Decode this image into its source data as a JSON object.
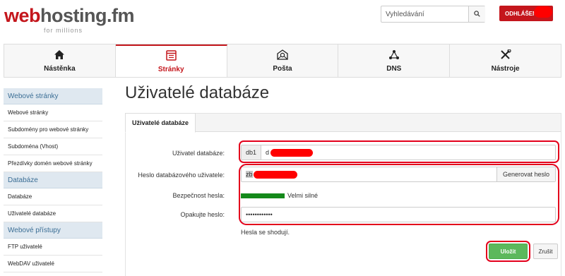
{
  "brand": {
    "logo_web": "web",
    "logo_rest": "hosting.fm",
    "tagline": "for millions"
  },
  "search": {
    "placeholder": "Vyhledávání",
    "button_icon": "search-icon"
  },
  "header": {
    "logout_label": "ODHLÁŠENÍ"
  },
  "topnav": {
    "items": [
      {
        "label": "Nástěnka",
        "icon": "home-icon",
        "glyph": "🏠︎"
      },
      {
        "label": "Stránky",
        "icon": "pages-icon",
        "glyph": "▤",
        "active": true
      },
      {
        "label": "Pošta",
        "icon": "mail-icon",
        "glyph": "✉"
      },
      {
        "label": "DNS",
        "icon": "dns-icon",
        "glyph": "⛬"
      },
      {
        "label": "Nástroje",
        "icon": "tools-icon",
        "glyph": "✂"
      }
    ]
  },
  "sidebar": {
    "sections": [
      {
        "title": "Webové stránky",
        "items": [
          "Webové stránky",
          "Subdomény pro webové stránky",
          "Subdoména (Vhost)",
          "Přezdívky domén webové stránky"
        ]
      },
      {
        "title": "Databáze",
        "items": [
          "Databáze",
          "Uživatelé databáze"
        ]
      },
      {
        "title": "Webové přístupy",
        "items": [
          "FTP uživatelé",
          "WebDAV uživatelé"
        ]
      }
    ]
  },
  "page": {
    "title": "Uživatelé databáze"
  },
  "panel": {
    "tab_label": "Uživatelé databáze",
    "fields": {
      "db_user_label": "Uživatel databáze:",
      "db_user_prefix": "db1",
      "db_user_value": "d",
      "password_label": "Heslo databázového uživatele:",
      "password_value": "zb",
      "generate_label": "Generovat heslo",
      "strength_label": "Bezpečnost hesla:",
      "strength_value": "Velmi silné",
      "strength_level": 1.0,
      "repeat_label": "Opakujte heslo:",
      "repeat_value": "••••••••••••",
      "match_text": "Hesla se shodují."
    },
    "save_label": "Uložit",
    "cancel_label": "Zrušit"
  },
  "colors": {
    "brand_red": "#c4161c",
    "success_green": "#5cb85c",
    "strength_green": "#14891a",
    "highlight_red": "#e3001b"
  }
}
